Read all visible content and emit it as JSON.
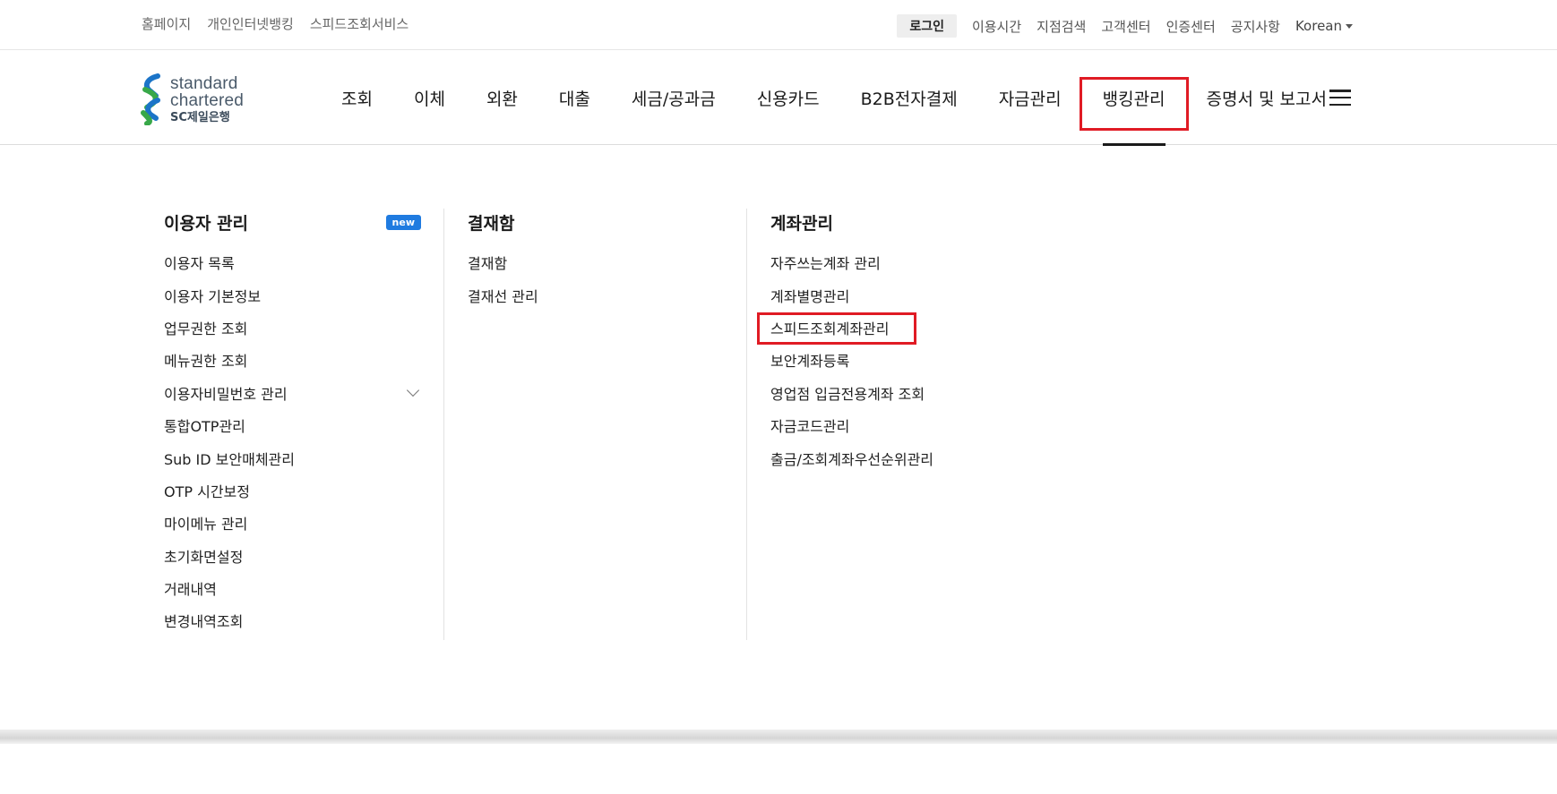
{
  "utility": {
    "left_links": [
      "홈페이지",
      "개인인터넷뱅킹",
      "스피드조회서비스"
    ],
    "login": "로그인",
    "right_links": [
      "이용시간",
      "지점검색",
      "고객센터",
      "인증센터",
      "공지사항"
    ],
    "language": "Korean"
  },
  "logo": {
    "line1": "standard",
    "line2": "chartered",
    "line3": "SC제일은행"
  },
  "colors": {
    "accent_red": "#e01b24",
    "badge_blue": "#1f7be0",
    "logo_green": "#38a849",
    "logo_blue": "#1b74c8"
  },
  "nav": {
    "items": [
      "조회",
      "이체",
      "외환",
      "대출",
      "세금/공과금",
      "신용카드",
      "B2B전자결제",
      "자금관리",
      "뱅킹관리",
      "증명서 및 보고서"
    ],
    "active": "뱅킹관리"
  },
  "dropdown": {
    "col1": {
      "title": "이용자 관리",
      "badge": "new",
      "items": [
        "이용자 목록",
        "이용자 기본정보",
        "업무권한 조회",
        "메뉴권한 조회",
        "이용자비밀번호 관리",
        "통합OTP관리",
        "Sub ID 보안매체관리",
        "OTP 시간보정",
        "마이메뉴 관리",
        "초기화면설정",
        "거래내역",
        "변경내역조회"
      ]
    },
    "col2": {
      "title": "결재함",
      "items": [
        "결재함",
        "결재선 관리"
      ]
    },
    "col3": {
      "title": "계좌관리",
      "items": [
        "자주쓰는계좌 관리",
        "계좌별명관리",
        "스피드조회계좌관리",
        "보안계좌등록",
        "영업점 입금전용계좌 조회",
        "자금코드관리",
        "출금/조회계좌우선순위관리"
      ],
      "highlighted": "스피드조회계좌관리"
    }
  }
}
